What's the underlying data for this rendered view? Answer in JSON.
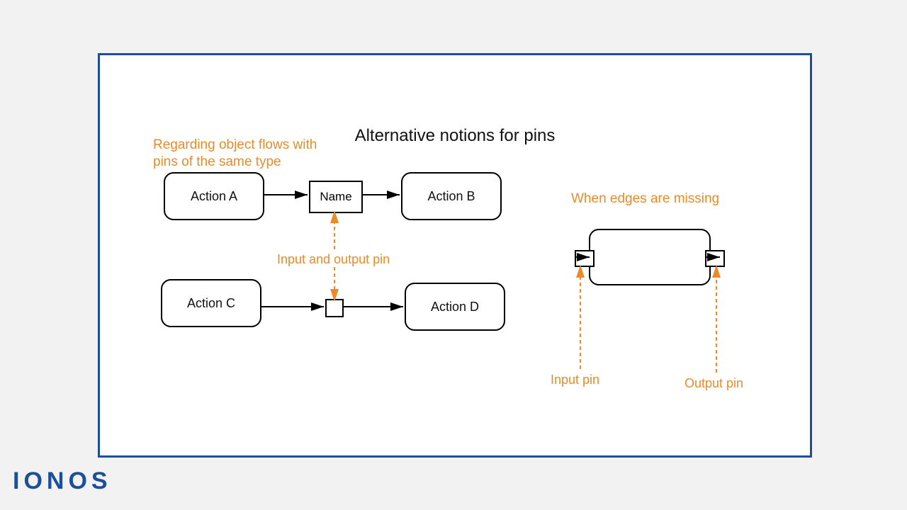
{
  "title": "Alternative notions for pins",
  "caption_left": "Regarding object flows with\npins of the same type",
  "caption_right": "When edges are missing",
  "actions": {
    "A": "Action A",
    "B": "Action B",
    "C": "Action C",
    "D": "Action D"
  },
  "name_box": "Name",
  "labels": {
    "input_output_pin": "Input and output pin",
    "input_pin": "Input pin",
    "output_pin": "Output pin"
  },
  "logo": "IONOS"
}
